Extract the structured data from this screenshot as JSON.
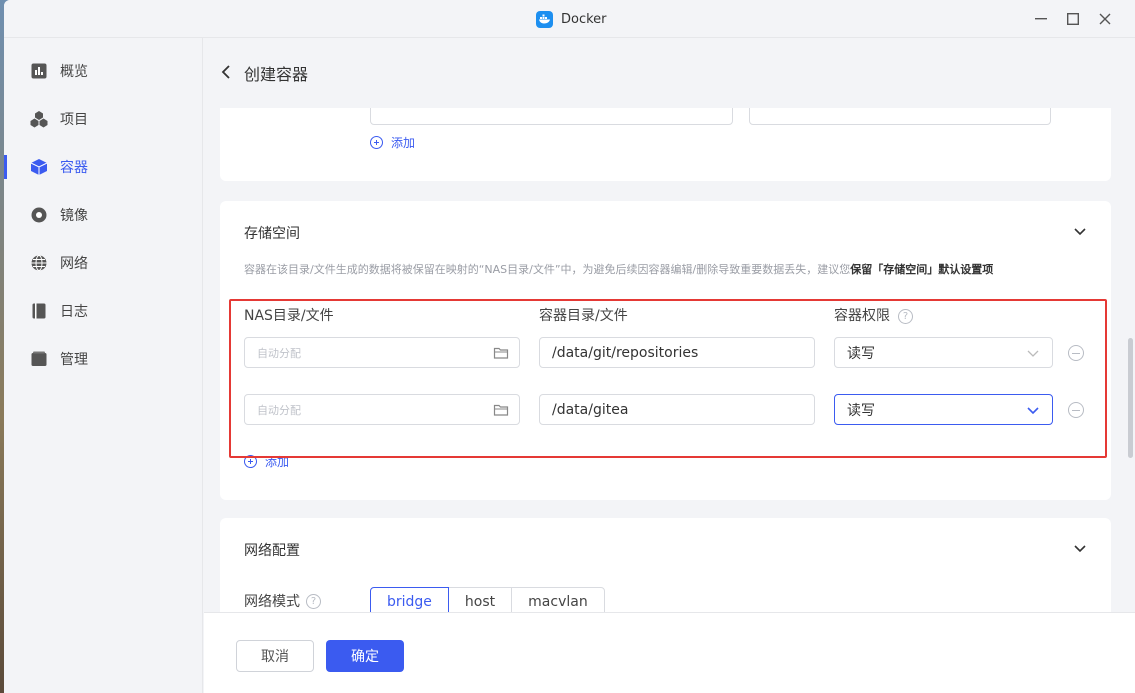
{
  "window": {
    "title": "Docker"
  },
  "sidebar": {
    "items": [
      {
        "label": "概览",
        "icon": "overview-icon"
      },
      {
        "label": "项目",
        "icon": "project-icon"
      },
      {
        "label": "容器",
        "icon": "container-icon",
        "active": true
      },
      {
        "label": "镜像",
        "icon": "image-icon"
      },
      {
        "label": "网络",
        "icon": "network-icon"
      },
      {
        "label": "日志",
        "icon": "log-icon"
      },
      {
        "label": "管理",
        "icon": "manage-icon"
      }
    ]
  },
  "header": {
    "title": "创建容器"
  },
  "prev_section": {
    "add_label": "添加"
  },
  "storage": {
    "title": "存储空间",
    "description_prefix": "容器在该目录/文件生成的数据将被保留在映射的“NAS目录/文件”中，为避免后续因容器编辑/删除导致重要数据丢失，建议您",
    "description_bold": "保留「存储空间」默认设置项",
    "col_nas": "NAS目录/文件",
    "col_container": "容器目录/文件",
    "col_permission": "容器权限",
    "help_glyph": "?",
    "rows": [
      {
        "nas_placeholder": "自动分配",
        "container_path": "/data/git/repositories",
        "permission": "读写"
      },
      {
        "nas_placeholder": "自动分配",
        "container_path": "/data/gitea",
        "permission": "读写"
      }
    ],
    "add_label": "添加"
  },
  "network": {
    "title": "网络配置",
    "mode_label": "网络模式",
    "modes": [
      "bridge",
      "host",
      "macvlan"
    ],
    "selected_mode": "bridge"
  },
  "footer": {
    "cancel_label": "取消",
    "ok_label": "确定"
  },
  "colors": {
    "accent": "#3b5bf0",
    "highlight": "#e53935"
  }
}
